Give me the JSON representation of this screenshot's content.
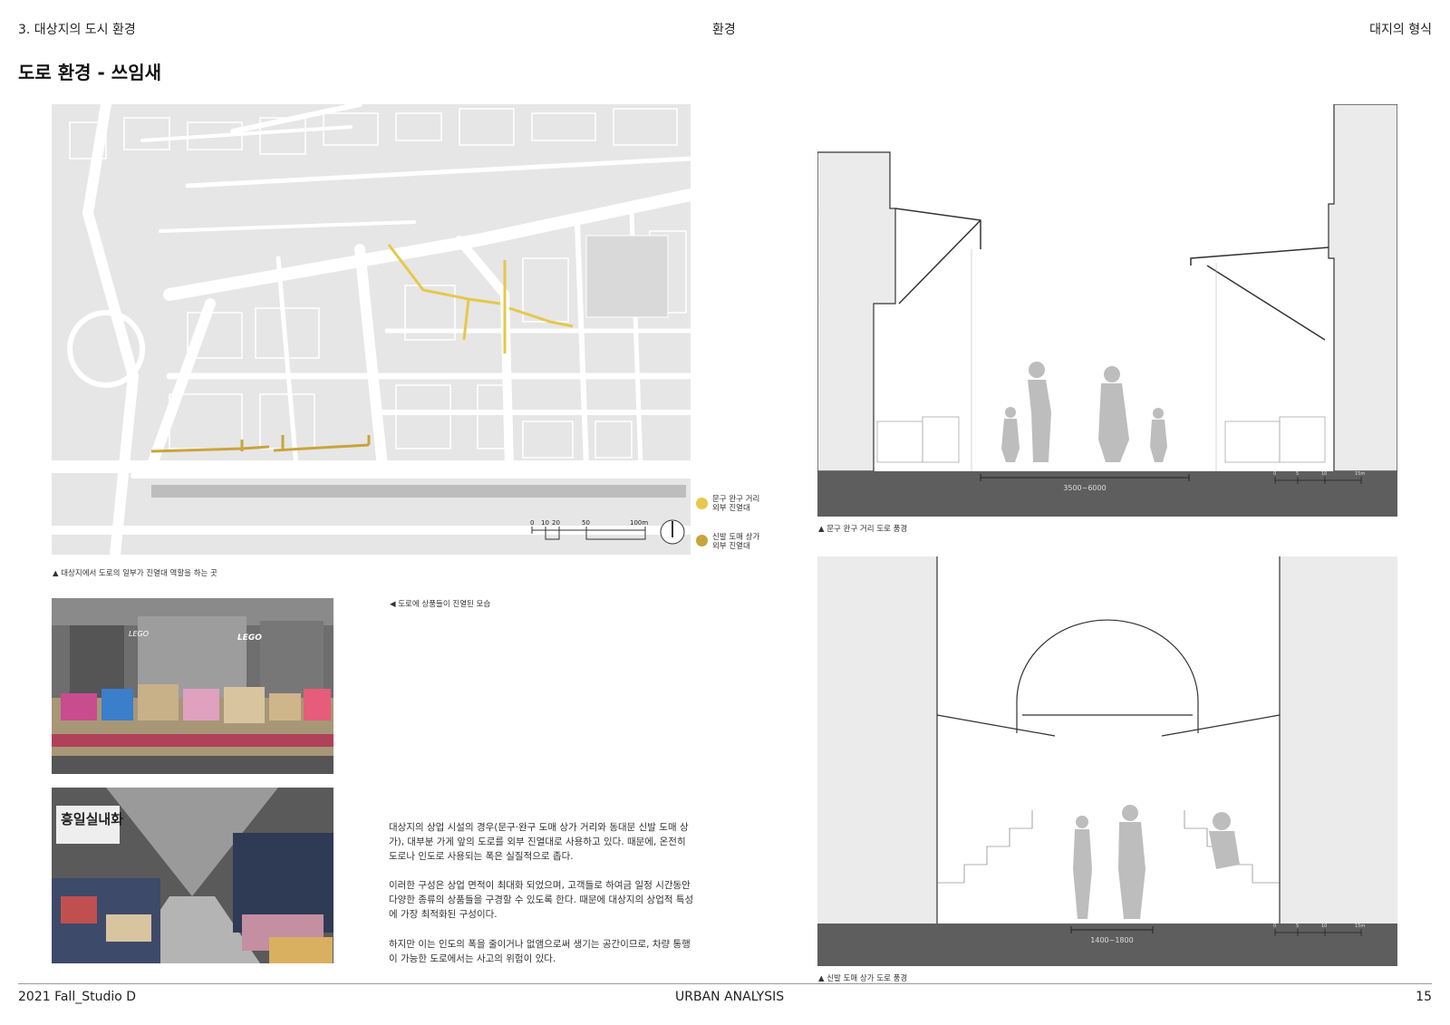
{
  "header": {
    "left": "3. 대상지의 도시 환경",
    "center": "환경",
    "right": "대지의 형식"
  },
  "page_title": "도로 환경 - 쓰임새",
  "map": {
    "caption": "▲ 대상지에서 도로의 일부가 진열대 역할을 하는 곳",
    "scale_labels": [
      "0",
      "10",
      "20",
      "50",
      "100m"
    ],
    "legend": [
      {
        "label": "문구 완구 거리\n외부 진열대",
        "color": "#e6c84a"
      },
      {
        "label": "신발 도매 상가\n외부 진열대",
        "color": "#c9a43c"
      }
    ]
  },
  "photos": {
    "caption": "◀ 도로에 상품들이 진열된 모습",
    "photo1_sign": "LEGO",
    "photo2_sign": "흥일실내화"
  },
  "body_paragraphs": [
    " 대상지의 상업 시설의 경우(문구·완구 도매 상가 거리와 동대문 신발 도매 상가), 대부분 가게 앞의 도로를 외부 진열대로 사용하고 있다. 때문에, 온전히 도로나 인도로 사용되는 폭은 실질적으로 좁다.",
    " 이러한 구성은 상업 면적이 최대화 되었으며, 고객들로 하여금 일정 시간동안 다양한 종류의 상품들을 구경할 수 있도록 한다. 때문에 대상지의 상업적 특성에 가장 최적화된 구성이다.",
    " 하지만 이는 인도의 폭을 줄이거나 없앰으로써 생기는 공간이므로, 차량 통행이 가능한 도로에서는 사고의 위험이 있다."
  ],
  "sections": [
    {
      "caption": "▲ 문구 완구 거리 도로 풍경",
      "dimension": "3500~6000",
      "scale": [
        "0",
        "5",
        "10",
        "15m"
      ]
    },
    {
      "caption": "▲ 신발 도매 상가 도로 풍경",
      "dimension": "1400~1800",
      "scale": [
        "0",
        "5",
        "10",
        "15m"
      ]
    }
  ],
  "footer": {
    "left": "2021 Fall_Studio D",
    "center": "URBAN ANALYSIS",
    "right": "15"
  }
}
